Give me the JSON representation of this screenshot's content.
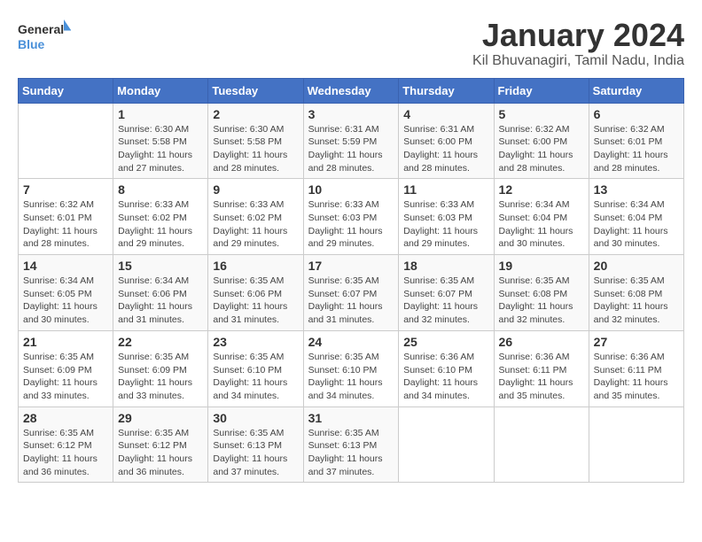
{
  "logo": {
    "general": "General",
    "blue": "Blue"
  },
  "title": "January 2024",
  "subtitle": "Kil Bhuvanagiri, Tamil Nadu, India",
  "headers": [
    "Sunday",
    "Monday",
    "Tuesday",
    "Wednesday",
    "Thursday",
    "Friday",
    "Saturday"
  ],
  "weeks": [
    [
      {
        "day": "",
        "info": ""
      },
      {
        "day": "1",
        "info": "Sunrise: 6:30 AM\nSunset: 5:58 PM\nDaylight: 11 hours\nand 27 minutes."
      },
      {
        "day": "2",
        "info": "Sunrise: 6:30 AM\nSunset: 5:58 PM\nDaylight: 11 hours\nand 28 minutes."
      },
      {
        "day": "3",
        "info": "Sunrise: 6:31 AM\nSunset: 5:59 PM\nDaylight: 11 hours\nand 28 minutes."
      },
      {
        "day": "4",
        "info": "Sunrise: 6:31 AM\nSunset: 6:00 PM\nDaylight: 11 hours\nand 28 minutes."
      },
      {
        "day": "5",
        "info": "Sunrise: 6:32 AM\nSunset: 6:00 PM\nDaylight: 11 hours\nand 28 minutes."
      },
      {
        "day": "6",
        "info": "Sunrise: 6:32 AM\nSunset: 6:01 PM\nDaylight: 11 hours\nand 28 minutes."
      }
    ],
    [
      {
        "day": "7",
        "info": "Sunrise: 6:32 AM\nSunset: 6:01 PM\nDaylight: 11 hours\nand 28 minutes."
      },
      {
        "day": "8",
        "info": "Sunrise: 6:33 AM\nSunset: 6:02 PM\nDaylight: 11 hours\nand 29 minutes."
      },
      {
        "day": "9",
        "info": "Sunrise: 6:33 AM\nSunset: 6:02 PM\nDaylight: 11 hours\nand 29 minutes."
      },
      {
        "day": "10",
        "info": "Sunrise: 6:33 AM\nSunset: 6:03 PM\nDaylight: 11 hours\nand 29 minutes."
      },
      {
        "day": "11",
        "info": "Sunrise: 6:33 AM\nSunset: 6:03 PM\nDaylight: 11 hours\nand 29 minutes."
      },
      {
        "day": "12",
        "info": "Sunrise: 6:34 AM\nSunset: 6:04 PM\nDaylight: 11 hours\nand 30 minutes."
      },
      {
        "day": "13",
        "info": "Sunrise: 6:34 AM\nSunset: 6:04 PM\nDaylight: 11 hours\nand 30 minutes."
      }
    ],
    [
      {
        "day": "14",
        "info": "Sunrise: 6:34 AM\nSunset: 6:05 PM\nDaylight: 11 hours\nand 30 minutes."
      },
      {
        "day": "15",
        "info": "Sunrise: 6:34 AM\nSunset: 6:06 PM\nDaylight: 11 hours\nand 31 minutes."
      },
      {
        "day": "16",
        "info": "Sunrise: 6:35 AM\nSunset: 6:06 PM\nDaylight: 11 hours\nand 31 minutes."
      },
      {
        "day": "17",
        "info": "Sunrise: 6:35 AM\nSunset: 6:07 PM\nDaylight: 11 hours\nand 31 minutes."
      },
      {
        "day": "18",
        "info": "Sunrise: 6:35 AM\nSunset: 6:07 PM\nDaylight: 11 hours\nand 32 minutes."
      },
      {
        "day": "19",
        "info": "Sunrise: 6:35 AM\nSunset: 6:08 PM\nDaylight: 11 hours\nand 32 minutes."
      },
      {
        "day": "20",
        "info": "Sunrise: 6:35 AM\nSunset: 6:08 PM\nDaylight: 11 hours\nand 32 minutes."
      }
    ],
    [
      {
        "day": "21",
        "info": "Sunrise: 6:35 AM\nSunset: 6:09 PM\nDaylight: 11 hours\nand 33 minutes."
      },
      {
        "day": "22",
        "info": "Sunrise: 6:35 AM\nSunset: 6:09 PM\nDaylight: 11 hours\nand 33 minutes."
      },
      {
        "day": "23",
        "info": "Sunrise: 6:35 AM\nSunset: 6:10 PM\nDaylight: 11 hours\nand 34 minutes."
      },
      {
        "day": "24",
        "info": "Sunrise: 6:35 AM\nSunset: 6:10 PM\nDaylight: 11 hours\nand 34 minutes."
      },
      {
        "day": "25",
        "info": "Sunrise: 6:36 AM\nSunset: 6:10 PM\nDaylight: 11 hours\nand 34 minutes."
      },
      {
        "day": "26",
        "info": "Sunrise: 6:36 AM\nSunset: 6:11 PM\nDaylight: 11 hours\nand 35 minutes."
      },
      {
        "day": "27",
        "info": "Sunrise: 6:36 AM\nSunset: 6:11 PM\nDaylight: 11 hours\nand 35 minutes."
      }
    ],
    [
      {
        "day": "28",
        "info": "Sunrise: 6:35 AM\nSunset: 6:12 PM\nDaylight: 11 hours\nand 36 minutes."
      },
      {
        "day": "29",
        "info": "Sunrise: 6:35 AM\nSunset: 6:12 PM\nDaylight: 11 hours\nand 36 minutes."
      },
      {
        "day": "30",
        "info": "Sunrise: 6:35 AM\nSunset: 6:13 PM\nDaylight: 11 hours\nand 37 minutes."
      },
      {
        "day": "31",
        "info": "Sunrise: 6:35 AM\nSunset: 6:13 PM\nDaylight: 11 hours\nand 37 minutes."
      },
      {
        "day": "",
        "info": ""
      },
      {
        "day": "",
        "info": ""
      },
      {
        "day": "",
        "info": ""
      }
    ]
  ]
}
